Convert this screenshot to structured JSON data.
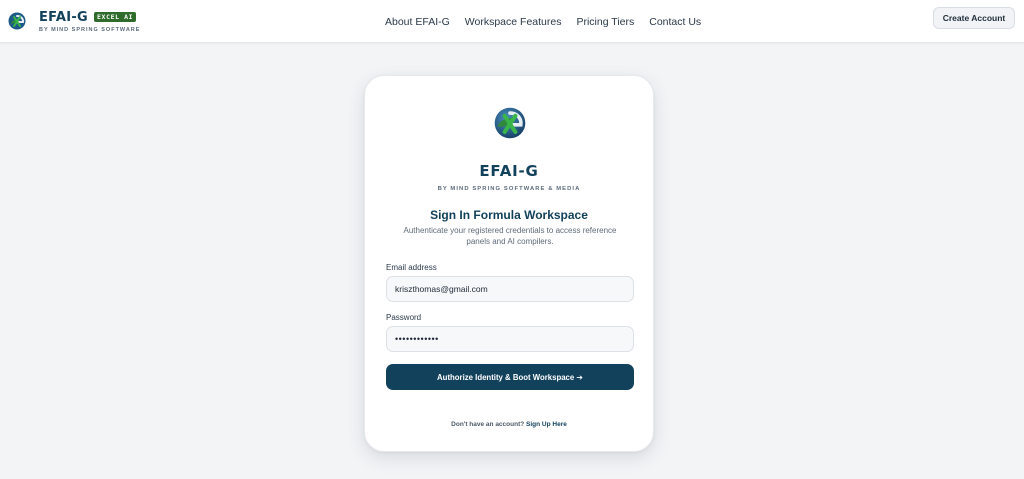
{
  "header": {
    "brand_name": "EFAI-G",
    "brand_badge": "EXCEL AI",
    "brand_tagline": "BY MIND SPRING SOFTWARE",
    "nav": [
      "About EFAI-G",
      "Workspace Features",
      "Pricing Tiers",
      "Contact Us"
    ],
    "create_account_label": "Create Account"
  },
  "card": {
    "title": "EFAI-G",
    "subtitle": "BY MIND SPRING SOFTWARE & MEDIA",
    "heading": "Sign In Formula Workspace",
    "description": "Authenticate your registered credentials to access reference panels and AI compilers.",
    "email_label": "Email address",
    "email_value": "kriszthomas@gmail.com",
    "password_label": "Password",
    "password_value": "••••••••••••",
    "submit_label": "Authorize Identity & Boot Workspace ➔",
    "signup_prompt": "Don't have an account?",
    "signup_link": "Sign Up Here"
  },
  "colors": {
    "brand_navy": "#12415c",
    "badge_green": "#2f6b2a",
    "page_bg": "#f3f4f6"
  },
  "icons": {
    "logo": "efai-g-globe-logo-icon"
  }
}
